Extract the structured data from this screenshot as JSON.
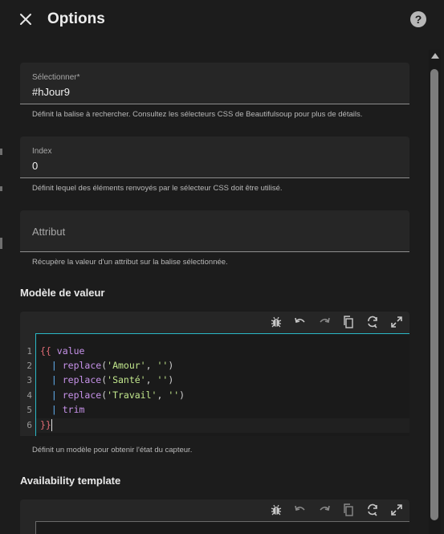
{
  "dialog": {
    "title": "Options",
    "close_icon": "close-icon",
    "help_icon": "help-icon",
    "help_glyph": "?"
  },
  "fields": {
    "selector": {
      "label": "Sélectionner*",
      "value": "#hJour9",
      "helper": "Définit la balise à rechercher. Consultez les sélecteurs CSS de Beautifulsoup pour plus de détails."
    },
    "index": {
      "label": "Index",
      "value": "0",
      "helper": "Définit lequel des éléments renvoyés par le sélecteur CSS doit être utilisé."
    },
    "attribute": {
      "placeholder": "Attribut",
      "helper": "Récupère la valeur d'un attribut sur la balise sélectionnée."
    }
  },
  "value_template": {
    "title": "Modèle de valeur",
    "helper": "Définit un modèle pour obtenir l'état du capteur.",
    "toolbar_icons": [
      "bug-icon",
      "undo-icon",
      "redo-icon",
      "copy-icon",
      "refresh-icon",
      "fullscreen-icon"
    ],
    "line_numbers": [
      "1",
      "2",
      "3",
      "4",
      "5",
      "6"
    ],
    "code": {
      "line1_open": "{{",
      "line1_var": "value",
      "line2_filter": "replace",
      "line2_arg": "'Amour'",
      "line3_filter": "replace",
      "line3_arg": "'Santé'",
      "line4_filter": "replace",
      "line4_arg": "'Travail'",
      "empty_arg": "''",
      "line5_filter": "trim",
      "line6_close": "}}",
      "pipe": "|"
    }
  },
  "availability_template": {
    "title": "Availability template",
    "toolbar_icons": [
      "bug-icon",
      "undo-icon",
      "redo-icon",
      "copy-icon",
      "refresh-icon",
      "fullscreen-icon"
    ]
  },
  "colors": {
    "background": "#1c1c1c",
    "field": "#262626",
    "accent": "#2ab8c6",
    "string": "#c3e88d",
    "keyword": "#c792ea",
    "brace": "#e06c75"
  }
}
